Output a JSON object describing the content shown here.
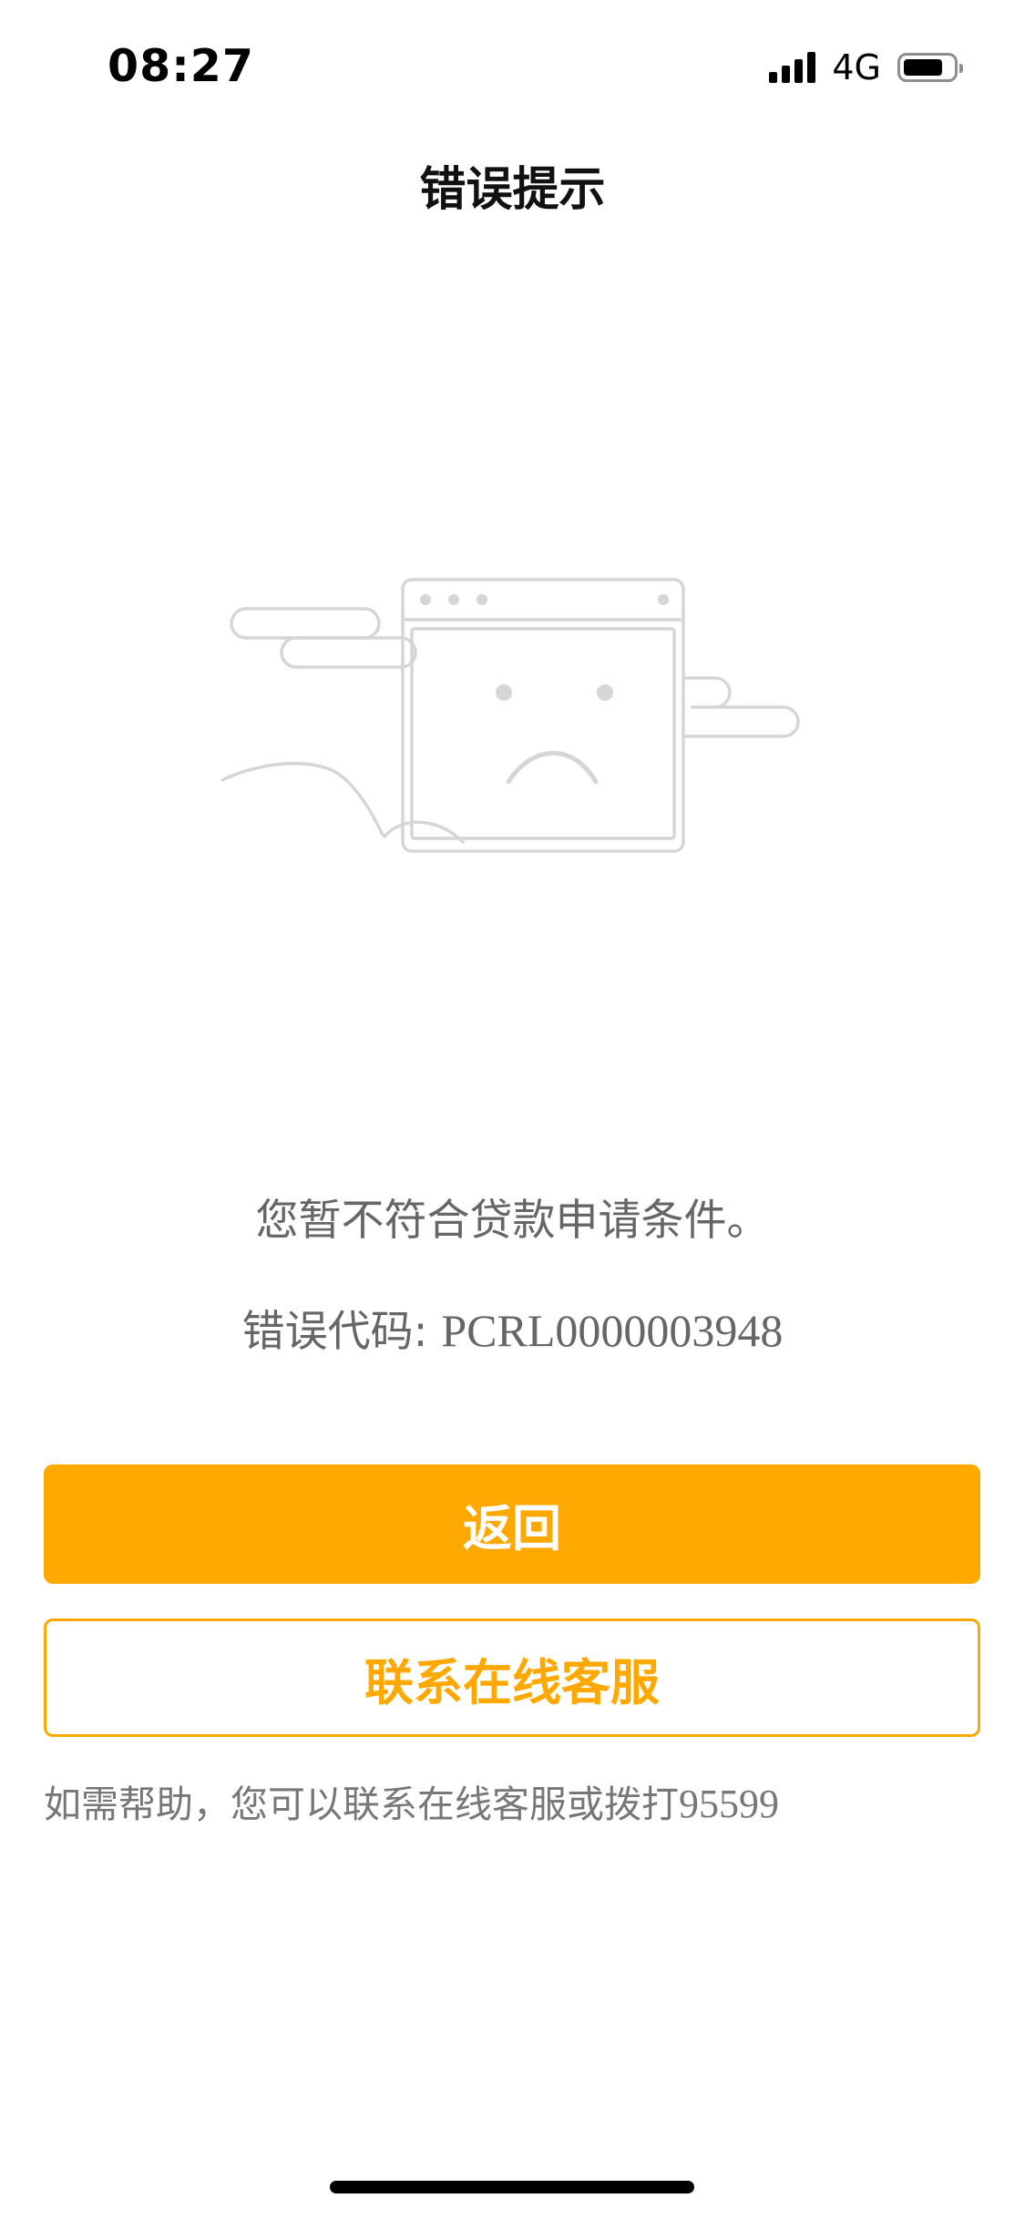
{
  "status_bar": {
    "time": "08:27",
    "network": "4G",
    "battery_level": 0.8
  },
  "nav": {
    "title": "错误提示"
  },
  "error": {
    "illustration_icon": "sad-browser-window-icon",
    "message": "您暂不符合贷款申请条件。",
    "code_label": "错误代码: ",
    "code_value": "PCRL0000003948"
  },
  "actions": {
    "back_label": "返回",
    "contact_label": "联系在线客服"
  },
  "help": {
    "text": "如需帮助，您可以联系在线客服或拨打",
    "phone": "95599"
  },
  "colors": {
    "accent": "#ffa800",
    "text_secondary": "#666666",
    "illustration_stroke": "#d6d6d6"
  }
}
